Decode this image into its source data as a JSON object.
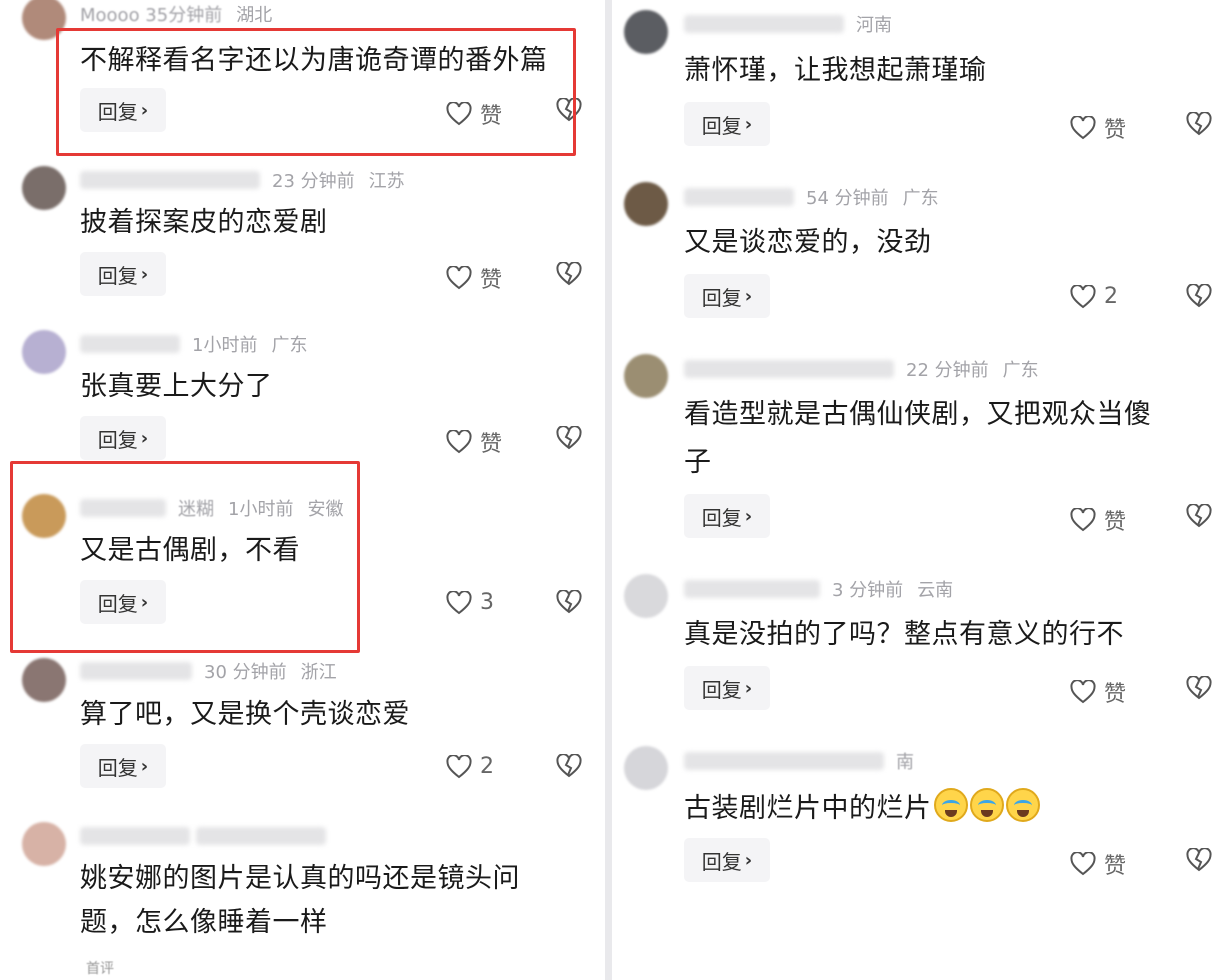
{
  "labels": {
    "reply": "回复",
    "like": "赞"
  },
  "colors": {
    "highlight": "#e53935",
    "meta": "#a3a3a8",
    "reply_bg": "#f4f4f6"
  },
  "icons": {
    "like": "heart-outline-icon",
    "dislike": "broken-heart-icon",
    "reply_chevron": "chevron-right-icon"
  },
  "left": [
    {
      "meta": [
        "Moooo 35分钟前",
        "湖北"
      ],
      "text": "不解释看名字还以为唐诡奇谭的番外篇",
      "likes": "赞",
      "highlighted": true
    },
    {
      "meta": [
        "23 分钟前",
        "江苏"
      ],
      "text": "披着探案皮的恋爱剧",
      "likes": "赞"
    },
    {
      "meta": [
        "1小时前",
        "广东"
      ],
      "text": "张真要上大分了",
      "likes": "赞"
    },
    {
      "meta": [
        "迷糊",
        "1小时前",
        "安徽"
      ],
      "text": "又是古偶剧，不看",
      "likes": "3",
      "highlighted": true
    },
    {
      "meta": [
        "30 分钟前",
        "浙江"
      ],
      "text": "算了吧，又是换个壳谈恋爱",
      "likes": "2"
    },
    {
      "meta": [],
      "text_lines": [
        "姚安娜的图片是认真的吗还是镜头问",
        "题，怎么像睡着一样"
      ],
      "fold": "首评"
    }
  ],
  "right": [
    {
      "meta": [
        "河南"
      ],
      "text": "萧怀瑾，让我想起萧瑾瑜",
      "likes": "赞"
    },
    {
      "meta": [
        "54 分钟前",
        "广东"
      ],
      "text": "又是谈恋爱的，没劲",
      "likes": "2"
    },
    {
      "meta": [
        "22 分钟前",
        "广东"
      ],
      "text_lines": [
        "看造型就是古偶仙侠剧，又把观众当傻",
        "子"
      ],
      "likes": "赞"
    },
    {
      "meta": [
        "3 分钟前",
        "云南"
      ],
      "text": "真是没拍的了吗？整点有意义的行不",
      "likes": "赞"
    },
    {
      "meta": [
        "南"
      ],
      "text": "古装剧烂片中的烂片",
      "emoji": "crying-face-emoji",
      "likes": "赞"
    }
  ]
}
